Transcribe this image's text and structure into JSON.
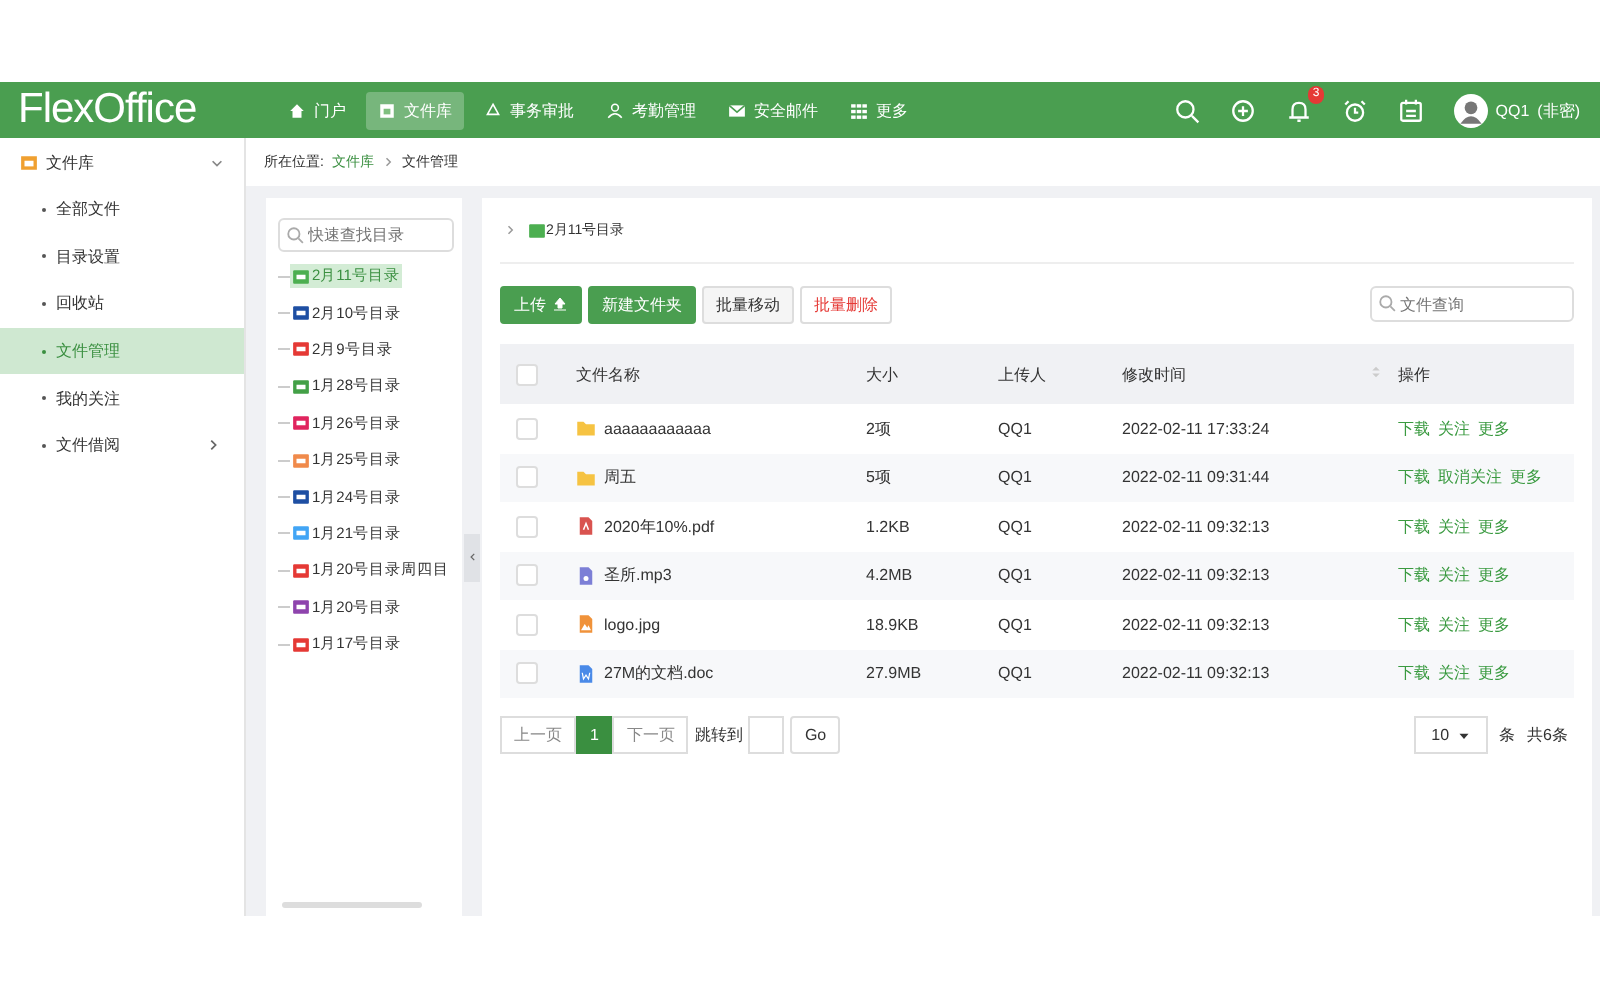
{
  "header": {
    "logo": "FlexOffice",
    "nav": [
      {
        "label": "门户",
        "selected": false
      },
      {
        "label": "文件库",
        "selected": true
      },
      {
        "label": "事务审批",
        "selected": false
      },
      {
        "label": "考勤管理",
        "selected": false
      },
      {
        "label": "安全邮件",
        "selected": false
      },
      {
        "label": "更多",
        "selected": false
      }
    ],
    "notification_count": "3",
    "user": "QQ1",
    "user_role": "(非密)"
  },
  "sidebar": {
    "title": "文件库",
    "items": [
      {
        "label": "全部文件",
        "selected": false,
        "has_children": false
      },
      {
        "label": "目录设置",
        "selected": false,
        "has_children": false
      },
      {
        "label": "回收站",
        "selected": false,
        "has_children": false
      },
      {
        "label": "文件管理",
        "selected": true,
        "has_children": false
      },
      {
        "label": "我的关注",
        "selected": false,
        "has_children": false
      },
      {
        "label": "文件借阅",
        "selected": false,
        "has_children": true
      }
    ]
  },
  "breadcrumb": {
    "prefix": "所在位置:",
    "items": [
      "文件库",
      "文件管理"
    ]
  },
  "tree": {
    "search_placeholder": "快速查找目录",
    "items": [
      {
        "label": "2月11号目录",
        "color": "#4caf50",
        "selected": true
      },
      {
        "label": "2月10号目录",
        "color": "#1e4fa3",
        "selected": false
      },
      {
        "label": "2月9号目录",
        "color": "#e53935",
        "selected": false
      },
      {
        "label": "1月28号目录",
        "color": "#43a047",
        "selected": false
      },
      {
        "label": "1月26号目录",
        "color": "#e0245e",
        "selected": false
      },
      {
        "label": "1月25号目录",
        "color": "#f08a4b",
        "selected": false
      },
      {
        "label": "1月24号目录",
        "color": "#1e4fa3",
        "selected": false
      },
      {
        "label": "1月21号目录",
        "color": "#42a5f5",
        "selected": false
      },
      {
        "label": "1月20号目录周四目",
        "color": "#e53935",
        "selected": false
      },
      {
        "label": "1月20号目录",
        "color": "#8e44ad",
        "selected": false
      },
      {
        "label": "1月17号目录",
        "color": "#e53935",
        "selected": false
      }
    ]
  },
  "main": {
    "current_folder": "2月11号目录",
    "toolbar": [
      {
        "label": "上传",
        "kind": "upload"
      },
      {
        "label": "新建文件夹",
        "kind": "primary"
      },
      {
        "label": "批量移动",
        "kind": "default"
      },
      {
        "label": "批量删除",
        "kind": "danger"
      }
    ],
    "search_placeholder": "文件查询",
    "table": {
      "select_all_checked": false,
      "columns": [
        "文件名称",
        "大小",
        "上传人",
        "修改时间",
        "操作"
      ],
      "rows": [
        {
          "kind": "folder",
          "name": "aaaaaaaaaaaa",
          "size": "2项",
          "uploader": "QQ1",
          "modified": "2022-02-11 17:33:24",
          "actions": [
            "下载",
            "关注",
            "更多"
          ],
          "checked": false
        },
        {
          "kind": "folder",
          "name": "周五",
          "size": "5项",
          "uploader": "QQ1",
          "modified": "2022-02-11 09:31:44",
          "actions": [
            "下载",
            "取消关注",
            "更多"
          ],
          "checked": false
        },
        {
          "kind": "pdf",
          "name": "2020年10%.pdf",
          "size": "1.2KB",
          "uploader": "QQ1",
          "modified": "2022-02-11 09:32:13",
          "actions": [
            "下载",
            "关注",
            "更多"
          ],
          "checked": false
        },
        {
          "kind": "audio",
          "name": "圣所.mp3",
          "size": "4.2MB",
          "uploader": "QQ1",
          "modified": "2022-02-11 09:32:13",
          "actions": [
            "下载",
            "关注",
            "更多"
          ],
          "checked": false
        },
        {
          "kind": "image",
          "name": "logo.jpg",
          "size": "18.9KB",
          "uploader": "QQ1",
          "modified": "2022-02-11 09:32:13",
          "actions": [
            "下载",
            "关注",
            "更多"
          ],
          "checked": false
        },
        {
          "kind": "word",
          "name": "27M的文档.doc",
          "size": "27.9MB",
          "uploader": "QQ1",
          "modified": "2022-02-11 09:32:13",
          "actions": [
            "下载",
            "关注",
            "更多"
          ],
          "checked": false
        }
      ]
    },
    "pagination": {
      "prev": "上一页",
      "pages": [
        {
          "label": "1",
          "selected": true
        }
      ],
      "next": "下一页",
      "jump_label": "跳转到",
      "go": "Go",
      "page_size": "10",
      "unit": "条",
      "total": "共6条"
    }
  }
}
